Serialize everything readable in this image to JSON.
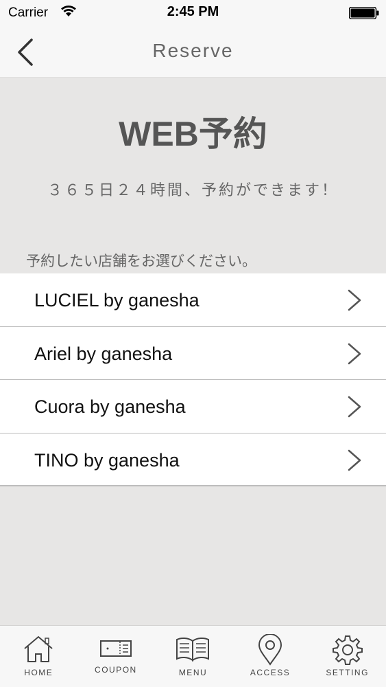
{
  "status_bar": {
    "carrier": "Carrier",
    "time": "2:45 PM"
  },
  "nav": {
    "title": "Reserve"
  },
  "hero": {
    "heading": "WEB予約",
    "subheading": "３６５日２４時間、予約ができます！"
  },
  "prompt": "予約したい店舗をお選びください。",
  "stores": [
    {
      "label": "LUCIEL by ganesha"
    },
    {
      "label": "Ariel by ganesha"
    },
    {
      "label": "Cuora by ganesha"
    },
    {
      "label": "TINO by ganesha"
    }
  ],
  "tabs": [
    {
      "label": "HOME",
      "icon": "home-icon"
    },
    {
      "label": "COUPON",
      "icon": "coupon-icon"
    },
    {
      "label": "MENU",
      "icon": "book-icon"
    },
    {
      "label": "ACCESS",
      "icon": "map-pin-icon"
    },
    {
      "label": "SETTING",
      "icon": "gear-icon"
    }
  ]
}
